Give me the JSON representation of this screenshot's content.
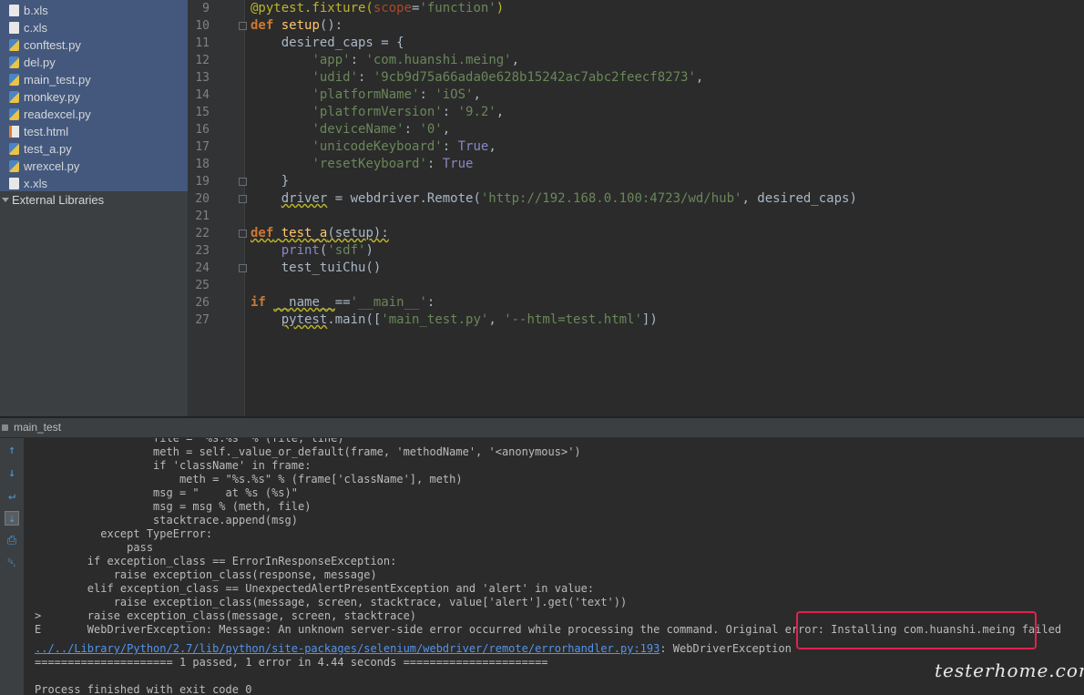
{
  "project_tree": {
    "files": [
      {
        "name": "b.xls",
        "type": "xls"
      },
      {
        "name": "c.xls",
        "type": "xls"
      },
      {
        "name": "conftest.py",
        "type": "py"
      },
      {
        "name": "del.py",
        "type": "py"
      },
      {
        "name": "main_test.py",
        "type": "py"
      },
      {
        "name": "monkey.py",
        "type": "py"
      },
      {
        "name": "readexcel.py",
        "type": "py"
      },
      {
        "name": "test.html",
        "type": "html"
      },
      {
        "name": "test_a.py",
        "type": "py"
      },
      {
        "name": "wrexcel.py",
        "type": "py"
      },
      {
        "name": "x.xls",
        "type": "xls"
      }
    ],
    "external_libraries": "External Libraries"
  },
  "editor": {
    "line_numbers": [
      "9",
      "10",
      "11",
      "12",
      "13",
      "14",
      "15",
      "16",
      "17",
      "18",
      "19",
      "20",
      "21",
      "22",
      "23",
      "24",
      "25",
      "26",
      "27"
    ]
  },
  "run_panel": {
    "tab_label": "main_test",
    "toolbar_icons": [
      "up-arrow-icon",
      "down-arrow-icon",
      "soft-wrap-icon",
      "scroll-to-end-icon",
      "print-icon",
      "trash-icon"
    ],
    "console_lines": [
      "                  file = \"%s:%s\" % (file, line)",
      "                  meth = self._value_or_default(frame, 'methodName', '<anonymous>')",
      "                  if 'className' in frame:",
      "                      meth = \"%s.%s\" % (frame['className'], meth)",
      "                  msg = \"    at %s (%s)\"",
      "                  msg = msg % (meth, file)",
      "                  stacktrace.append(msg)",
      "          except TypeError:",
      "              pass",
      "        if exception_class == ErrorInResponseException:",
      "            raise exception_class(response, message)",
      "        elif exception_class == UnexpectedAlertPresentException and 'alert' in value:",
      "            raise exception_class(message, screen, stacktrace, value['alert'].get('text'))",
      ">       raise exception_class(message, screen, stacktrace)",
      "E       WebDriverException: Message: An unknown server-side error occurred while processing the command. Original error: Installing com.huanshi.meing failed"
    ],
    "error_link": "../../Library/Python/2.7/lib/python/site-packages/selenium/webdriver/remote/errorhandler.py:193",
    "error_suffix": ": WebDriverException",
    "summary": "===================== 1 passed, 1 error in 4.44 seconds ======================",
    "exit_line": "Process finished with exit code 0"
  },
  "watermark": "testerhome.com",
  "colors": {
    "highlight_box": "#e0224f",
    "selection": "#4b6eaf",
    "link": "#5394ec"
  }
}
